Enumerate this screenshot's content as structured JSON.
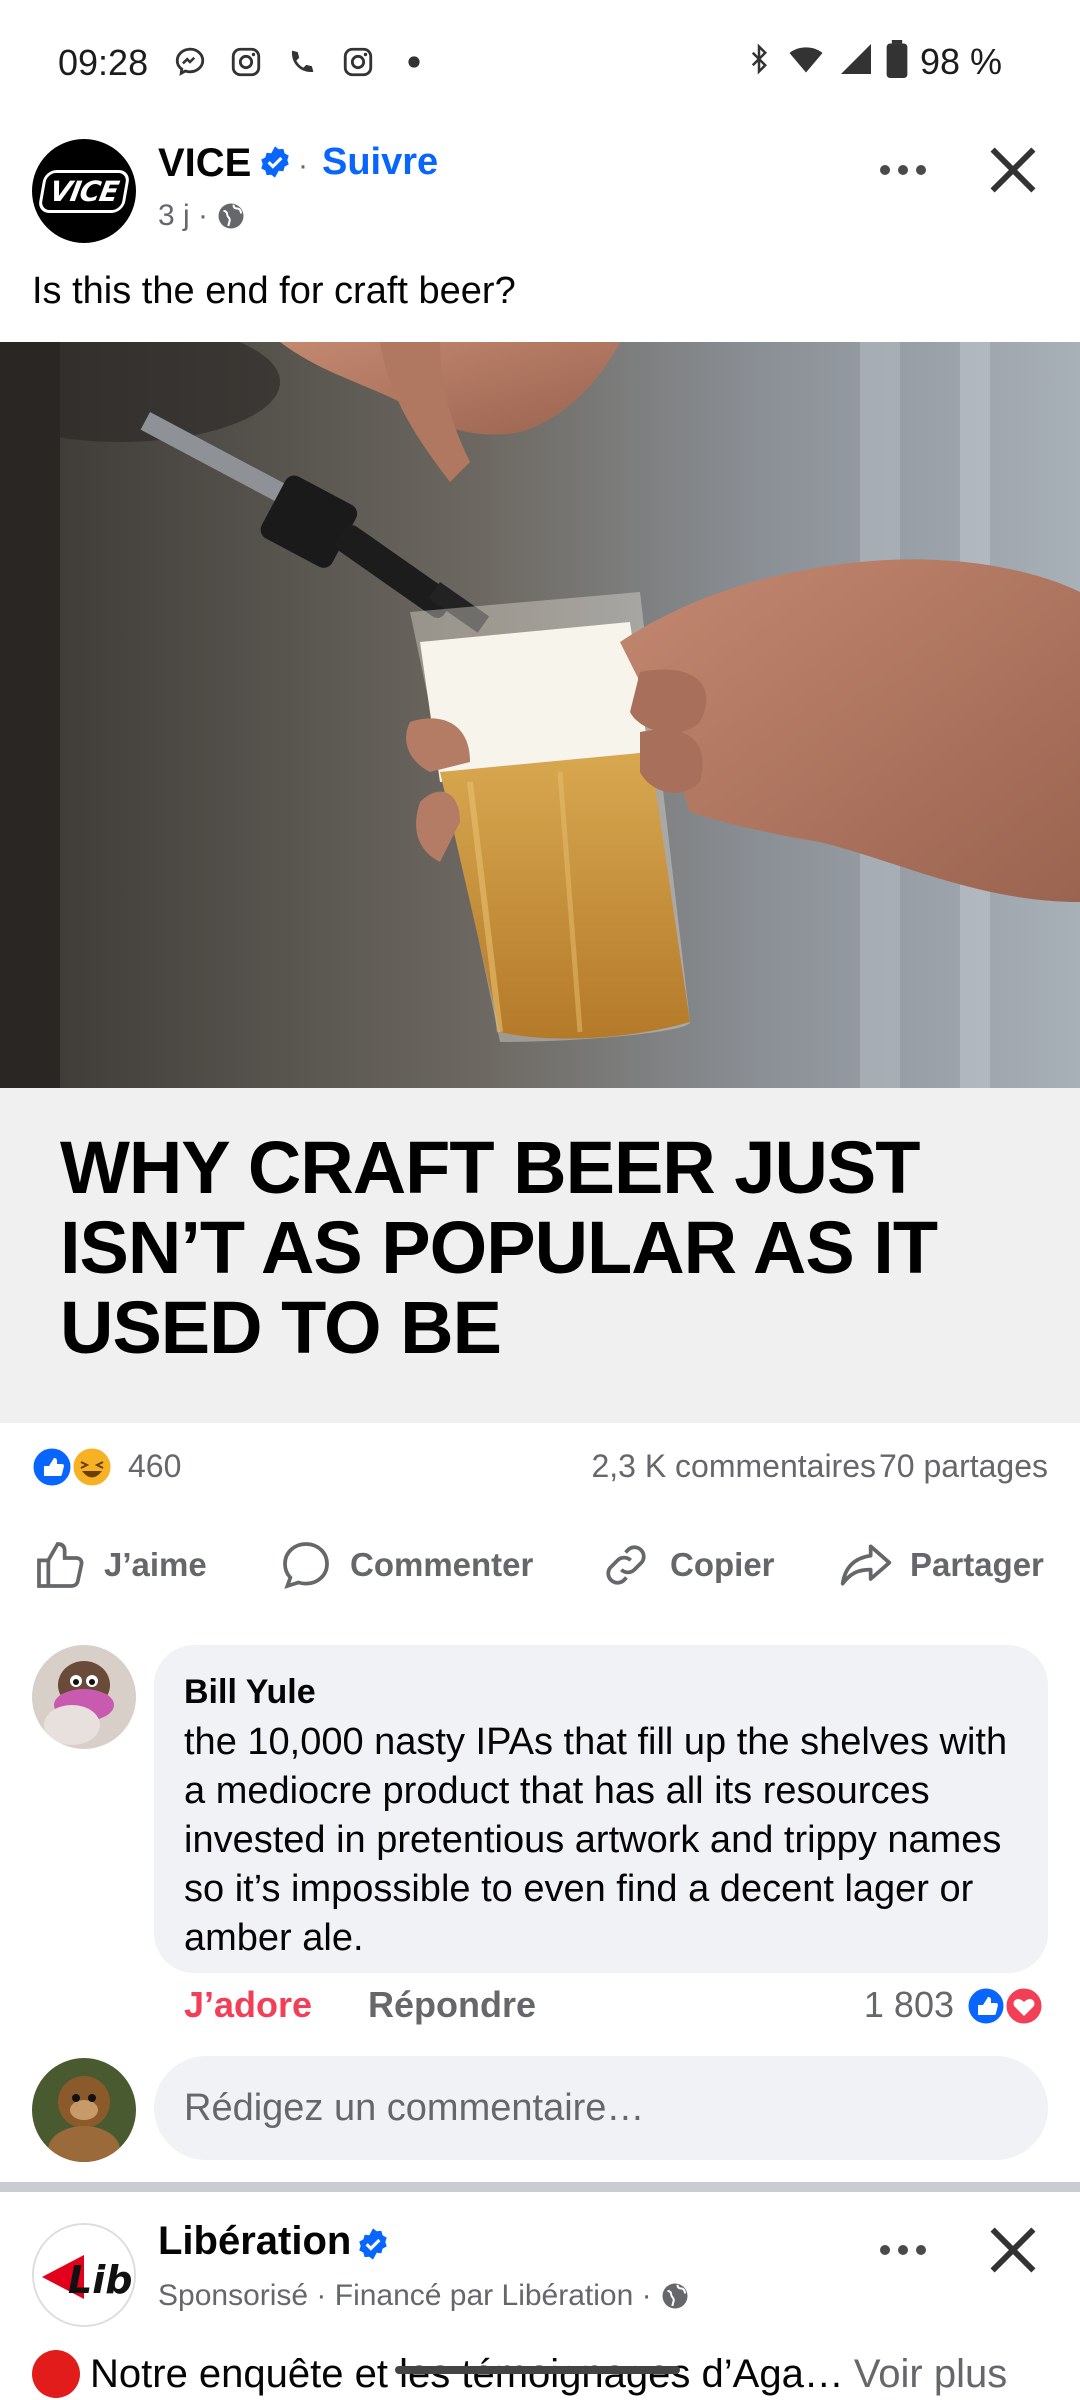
{
  "status_bar": {
    "time": "09:28",
    "battery": "98 %",
    "left_icons": [
      "messenger-icon",
      "instagram-icon",
      "phone-icon",
      "instagram-icon",
      "dot-icon"
    ],
    "right_icons": [
      "bluetooth-icon",
      "wifi-icon",
      "signal-icon",
      "battery-icon"
    ]
  },
  "post": {
    "page_name": "VICE",
    "avatar_text": "VICE",
    "follow_separator": "·",
    "follow_label": "Suivre",
    "time": "3 j ·",
    "caption": "Is this the end for craft beer?",
    "link_headline": "WHY CRAFT BEER JUST ISN’T AS POPULAR AS IT USED TO BE",
    "reaction_count": "460",
    "comments_count": "2,3 K commentaires",
    "shares_count": "70 partages",
    "actions": {
      "like": "J’aime",
      "comment": "Commenter",
      "copy": "Copier",
      "share": "Partager"
    }
  },
  "comment": {
    "author": "Bill Yule",
    "text": "the 10,000 nasty IPAs that fill up the shelves with a mediocre product that has all its resources invested in pretentious artwork and trippy names so it’s impossible to even find a decent lager or amber ale.",
    "love_label": "J’adore",
    "reply_label": "Répondre",
    "reaction_count": "1 803"
  },
  "write_comment": {
    "placeholder": "Rédigez un commentaire…"
  },
  "post2": {
    "page_name": "Libération",
    "avatar_text": "Libé",
    "meta": "Sponsorisé · Financé par Libération ·",
    "text": "Notre enquête et les témoignages d’Aga…",
    "see_more": "Voir plus"
  },
  "colors": {
    "accent": "#0866ff",
    "love": "#f33e58",
    "muted": "#65676b",
    "card_bg": "#f0f0f0"
  }
}
